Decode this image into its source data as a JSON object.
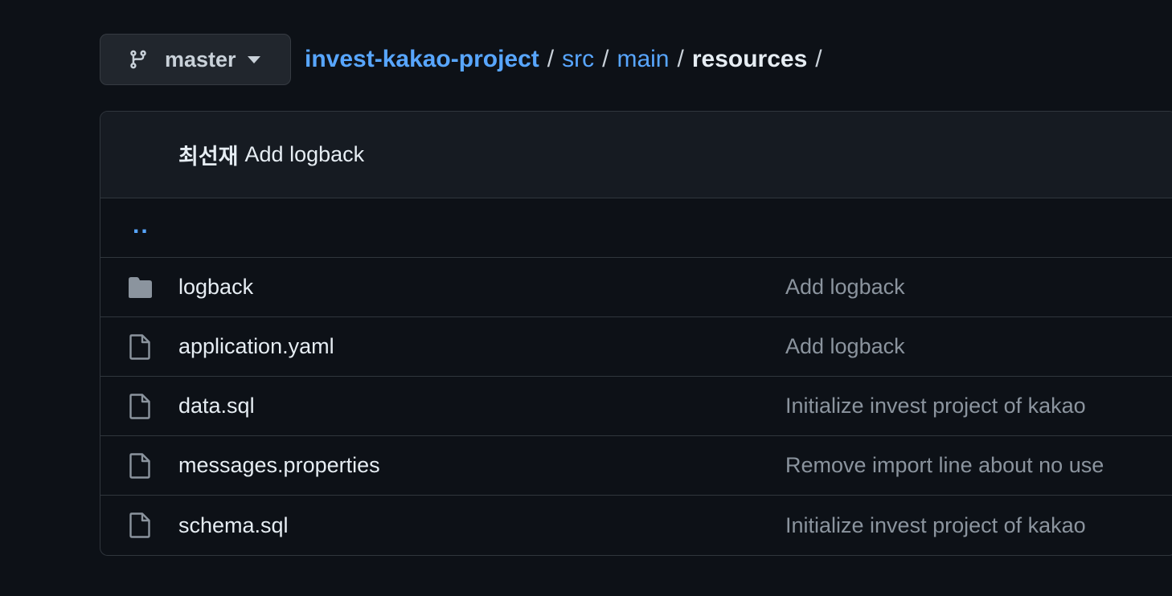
{
  "branch": {
    "label": "master",
    "icon": "git-branch-icon"
  },
  "breadcrumb": {
    "root": "invest-kakao-project",
    "segments": [
      "src",
      "main"
    ],
    "current": "resources",
    "separator": "/"
  },
  "latest_commit": {
    "author": "최선재",
    "message": "Add logback"
  },
  "parent_dir_label": "..",
  "files": [
    {
      "name": "logback",
      "type": "folder",
      "commit_message": "Add logback"
    },
    {
      "name": "application.yaml",
      "type": "file",
      "commit_message": "Add logback"
    },
    {
      "name": "data.sql",
      "type": "file",
      "commit_message": "Initialize invest project of kakao"
    },
    {
      "name": "messages.properties",
      "type": "file",
      "commit_message": "Remove import line about no use"
    },
    {
      "name": "schema.sql",
      "type": "file",
      "commit_message": "Initialize invest project of kakao"
    }
  ],
  "colors": {
    "background": "#0d1117",
    "link": "#58a6ff",
    "muted": "#8b949e",
    "border": "#30363d"
  }
}
